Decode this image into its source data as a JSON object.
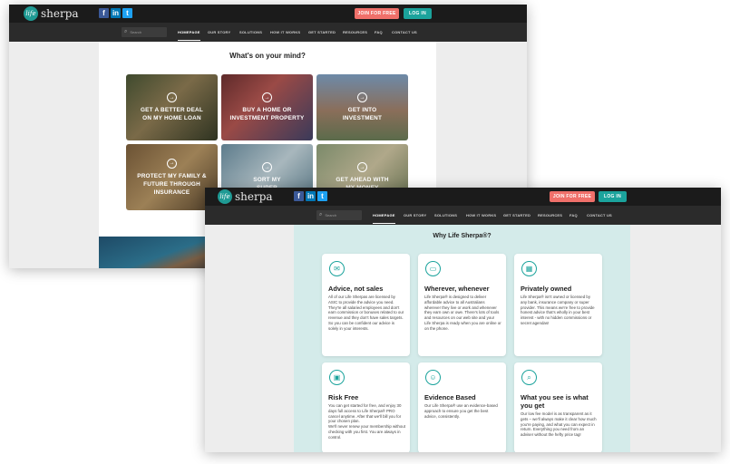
{
  "brand": {
    "logo_text": "sherpa",
    "logo_mark": "life"
  },
  "header": {
    "join_label": "JOIN FOR FREE",
    "login_label": "LOG IN",
    "social": [
      "f",
      "in",
      "t"
    ]
  },
  "nav": {
    "search_placeholder": "Search",
    "items": [
      "HOMEPAGE",
      "OUR STORY",
      "SOLUTIONS",
      "HOW IT WORKS",
      "GET STARTED",
      "RESOURCES",
      "FAQ",
      "CONTACT US"
    ],
    "active": "HOMEPAGE"
  },
  "screen1": {
    "heading": "What's on your mind?",
    "tiles": [
      {
        "label": "GET A BETTER DEAL\nON MY HOME LOAN"
      },
      {
        "label": "BUY A HOME OR\nINVESTMENT PROPERTY"
      },
      {
        "label": "GET INTO\nINVESTMENT"
      },
      {
        "label": "PROTECT MY FAMILY &\nFUTURE THROUGH\nINSURANCE"
      },
      {
        "label": "SORT MY\nSUPER"
      },
      {
        "label": "GET AHEAD WITH\nMY MONEY"
      }
    ]
  },
  "screen2": {
    "heading": "Why Life Sherpa®?",
    "cards": [
      {
        "title": "Advice, not sales",
        "body": "All of our Life Sherpas are licensed by ASIC to provide the advice you need.\nThey're all salaried employees and don't earn commission or bonuses related to our revenue and they don't have sales targets. So you can be confident our advice is solely in your interests.",
        "icon": "chat-icon"
      },
      {
        "title": "Wherever, whenever",
        "body": "Life Sherpa® is designed to deliver affordable advice to all Australians wherever they live or work and whenever they earn own or owe. There's lots of tools and resources on our web site and your Life Sherpa is ready when you are online or on the phone.",
        "icon": "device-icon"
      },
      {
        "title": "Privately owned",
        "body": "Life Sherpa® isn't owned or licensed by any bank, insurance company or super provider. This means we're free to provide honest advice that's wholly in your best interest - with no hidden commissions or secret agendas!",
        "icon": "chart-icon"
      },
      {
        "title": "Risk Free",
        "body": "You can get started for free, and enjoy 30 days full access to Life Sherpa® PRO cancel anytime. After that we'll bill you for your chosen plan.\nWe'll never renew your membership without checking with you first. You are always in control.",
        "icon": "gift-icon"
      },
      {
        "title": "Evidence Based",
        "body": "Our Life Sherpa® use an evidence-based approach to ensure you get the best advice, consistently.",
        "icon": "person-icon"
      },
      {
        "title": "What you see is what you get",
        "body": "Our low fee model is as transparent as it gets – we'll always make it clear how much you're paying, and what you can expect in return. Everything you need from an adviser without the hefty price tag!",
        "icon": "magnifier-icon"
      }
    ]
  }
}
